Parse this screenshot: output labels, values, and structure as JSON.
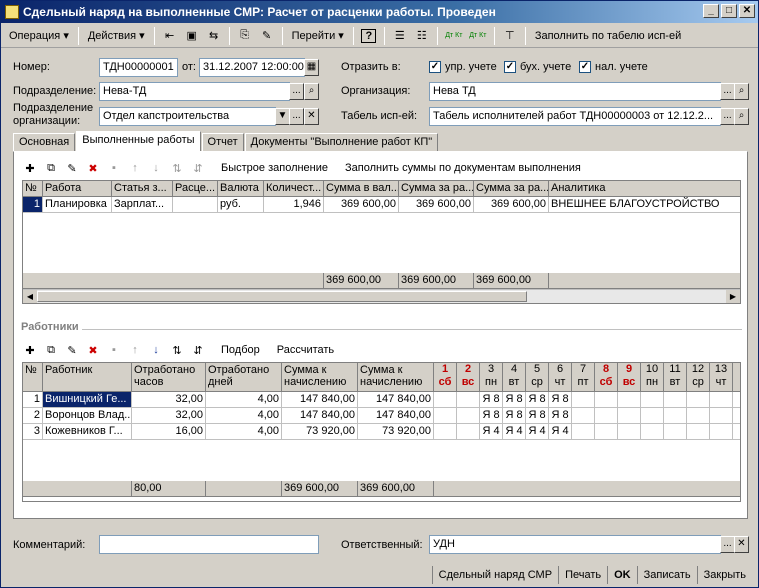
{
  "window": {
    "title": "Сдельный наряд на выполненные СМР: Расчет от расценки работы. Проведен",
    "btn_min": "_",
    "btn_max": "□",
    "btn_close": "✕"
  },
  "toolbar": {
    "operation": "Операция ▾",
    "actions": "Действия ▾",
    "goto": "Перейти ▾",
    "help": "?",
    "fill_by_timesheet": "Заполнить по табелю исп-ей",
    "dt_kt1": "Дт Кт",
    "dt_kt2": "Дт Кт"
  },
  "form": {
    "number_label": "Номер:",
    "number": "ТДН00000001",
    "date_label": "от:",
    "date": "31.12.2007 12:00:00",
    "reflect_label": "Отразить в:",
    "chk_upr": "упр. учете",
    "chk_buh": "бух. учете",
    "chk_nal": "нал. учете",
    "division_label": "Подразделение:",
    "division": "Нева-ТД",
    "org_label": "Организация:",
    "org": "Нева ТД",
    "orgdiv_label1": "Подразделение",
    "orgdiv_label2": "организации:",
    "orgdiv": "Отдел капстроительства",
    "timesheet_label": "Табель исп-ей:",
    "timesheet": "Табель исполнителей работ ТДН00000003 от 12.12.2..."
  },
  "tabs": [
    "Основная",
    "Выполненные работы",
    "Отчет",
    "Документы \"Выполнение работ КП\""
  ],
  "works_toolbar": {
    "quick_fill": "Быстрое заполнение",
    "fill_sums": "Заполнить суммы по документам выполнения"
  },
  "works": {
    "headers": [
      "№",
      "Работа",
      "Статья з...",
      "Расце...",
      "Валюта",
      "Количест...",
      "Сумма в вал...",
      "Сумма за ра...",
      "Сумма за ра...",
      "Аналитика"
    ],
    "rows": [
      [
        "1",
        "Планировка",
        "Зарплат...",
        "",
        "руб.",
        "1,946",
        "369 600,00",
        "369 600,00",
        "369 600,00",
        "ВНЕШНЕЕ БЛАГОУСТРОЙСТВО"
      ]
    ],
    "totals": [
      "369 600,00",
      "369 600,00",
      "369 600,00"
    ]
  },
  "workers_section": "Работники",
  "workers_toolbar": {
    "pick": "Подбор",
    "calc": "Рассчитать"
  },
  "workers": {
    "h_num": "№",
    "h_worker": "Работник",
    "h_hours1": "Отработано",
    "h_hours2": "часов",
    "h_days1": "Отработано",
    "h_days2": "дней",
    "h_sum1": "Сумма к",
    "h_sum2": "начислению",
    "h_sumb1": "Сумма к",
    "h_sumb2": "начислению",
    "days": [
      [
        "1",
        "сб"
      ],
      [
        "2",
        "вс"
      ],
      [
        "3",
        "пн"
      ],
      [
        "4",
        "вт"
      ],
      [
        "5",
        "ср"
      ],
      [
        "6",
        "чт"
      ],
      [
        "7",
        "пт"
      ],
      [
        "8",
        "сб"
      ],
      [
        "9",
        "вс"
      ],
      [
        "10",
        "пн"
      ],
      [
        "11",
        "вт"
      ],
      [
        "12",
        "ср"
      ],
      [
        "13",
        "чт"
      ],
      [
        "1",
        ""
      ]
    ],
    "rows": [
      {
        "n": "1",
        "name": "Вишницкий Ге...",
        "hours": "32,00",
        "days": "4,00",
        "sum": "147 840,00",
        "sumb": "147 840,00",
        "d": [
          "",
          "",
          "Я 8",
          "Я 8",
          "Я 8",
          "Я 8"
        ]
      },
      {
        "n": "2",
        "name": "Воронцов Влад...",
        "hours": "32,00",
        "days": "4,00",
        "sum": "147 840,00",
        "sumb": "147 840,00",
        "d": [
          "",
          "",
          "Я 8",
          "Я 8",
          "Я 8",
          "Я 8"
        ]
      },
      {
        "n": "3",
        "name": "Кожевников Г...",
        "hours": "16,00",
        "days": "4,00",
        "sum": "73 920,00",
        "sumb": "73 920,00",
        "d": [
          "",
          "",
          "Я 4",
          "Я 4",
          "Я 4",
          "Я 4"
        ]
      }
    ],
    "totals": {
      "hours": "80,00",
      "sum": "369 600,00",
      "sumb": "369 600,00"
    }
  },
  "footer": {
    "comment_label": "Комментарий:",
    "comment": "",
    "resp_label": "Ответственный:",
    "resp": "УДН"
  },
  "status": {
    "doc": "Сдельный наряд СМР",
    "print": "Печать",
    "ok": "OK",
    "save": "Записать",
    "close": "Закрыть"
  }
}
